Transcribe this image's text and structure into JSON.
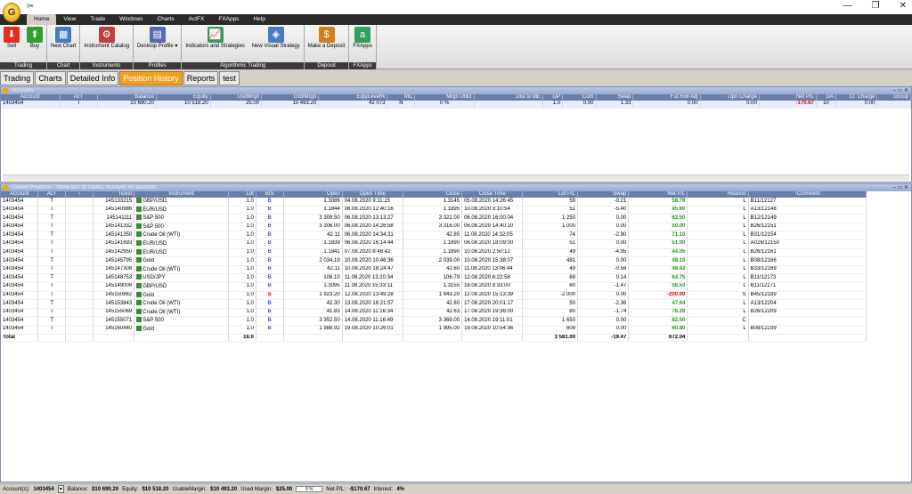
{
  "menu": [
    "Home",
    "View",
    "Trade",
    "Windows",
    "Charts",
    "ActFX",
    "FXApps",
    "Help"
  ],
  "ribbon": {
    "groups": [
      {
        "label": "Trading",
        "buttons": [
          {
            "name": "sell",
            "label": "Sell"
          },
          {
            "name": "buy",
            "label": "Buy"
          }
        ]
      },
      {
        "label": "Chart",
        "buttons": [
          {
            "name": "new-chart",
            "label": "New Chart"
          }
        ]
      },
      {
        "label": "Instruments",
        "buttons": [
          {
            "name": "instrument-catalog",
            "label": "Instrument Catalog"
          }
        ]
      },
      {
        "label": "Profiles",
        "buttons": [
          {
            "name": "desktop-profile",
            "label": "Desktop Profile ▾"
          }
        ]
      },
      {
        "label": "Algorithmic Trading",
        "buttons": [
          {
            "name": "indicators",
            "label": "Indicators and Strategies"
          },
          {
            "name": "new-visual-strategy",
            "label": "New Visual Strategy"
          }
        ]
      },
      {
        "label": "Deposit",
        "buttons": [
          {
            "name": "make-deposit",
            "label": "Make a Deposit"
          }
        ]
      },
      {
        "label": "FXApps",
        "buttons": [
          {
            "name": "fxapps",
            "label": "FXApps"
          }
        ]
      }
    ]
  },
  "tabs": [
    "Trading",
    "Charts",
    "Detailed Info",
    "Position History",
    "Reports",
    "test"
  ],
  "accounts": {
    "title": "Accounts",
    "columns": [
      "Account",
      "AcT",
      "Balance",
      "Equity",
      "UsdMrgn",
      "UsblMrgn",
      "EqtyLevel%",
      "MC",
      "Mrgn Utiliz",
      "Dist to ME",
      "OP",
      "Com",
      "Swap",
      "Fut Roll Adj",
      "Opn Charge",
      "Net P/L",
      "DA",
      "Cl. Charge",
      "Group"
    ],
    "row": [
      "1403454",
      "T",
      "10 690.20",
      "10 518.20",
      "25.00",
      "10 493.20",
      "42 073",
      "N",
      "0 %",
      "",
      "1.0",
      "0.00",
      "1.33",
      "0.00",
      "0.00",
      "-170.67",
      "10",
      "0.00",
      ""
    ]
  },
  "closed": {
    "title": "Closed Positions - Show last 30 trades; Account: All accounts",
    "columns": [
      "Account",
      "AcT",
      "↑",
      "Ticket",
      "Instrument",
      "Lot",
      "B/S",
      "Open",
      "Open Time",
      "Close",
      "Close Time",
      "Lot P/L",
      "Swap",
      "Net P/L",
      "Reason",
      "↑Comment"
    ],
    "rows": [
      [
        "1403454",
        "T",
        "",
        "145133215",
        "GBP/USD",
        "1.0",
        "B",
        "1.3086",
        "04.08.2020 9:11:15",
        "1.3145",
        "05.08.2020 14:26:45",
        "59",
        "-0.21",
        "58.79",
        "L",
        "B11/12127"
      ],
      [
        "1403454",
        "T",
        "",
        "145140986",
        "EUR/USD",
        "1.0",
        "B",
        "1.1844",
        "06.08.2020 12:40:16",
        "1.1895",
        "10.08.2020 3:10:54",
        "51",
        "-5.40",
        "45.60",
        "L",
        "A13/12148"
      ],
      [
        "1403454",
        "T",
        "",
        "145141111",
        "S&P 500",
        "1.0",
        "B",
        "3 309.50",
        "06.08.2020 13:13:27",
        "3 322.00",
        "06.08.2020 16:00:04",
        "1 250",
        "0.00",
        "62.50",
        "L",
        "B12/12149"
      ],
      [
        "1403454",
        "T",
        "",
        "145141332",
        "S&P 500",
        "1.0",
        "B",
        "3 306.00",
        "06.08.2020 14:26:58",
        "3 316.00",
        "06.08.2020 14:40:10",
        "1 000",
        "0.00",
        "50.00",
        "L",
        "B26/12151"
      ],
      [
        "1403454",
        "T",
        "",
        "145141350",
        "Crude Oil (WTI)",
        "1.0",
        "B",
        "42.11",
        "06.08.2020 14:34:31",
        "42.85",
        "11.08.2020 14:32:05",
        "74",
        "-2.90",
        "71.10",
        "L",
        "B31/12154"
      ],
      [
        "1403454",
        "T",
        "",
        "145141693",
        "EUR/USD",
        "1.0",
        "B",
        "1.1839",
        "06.08.2020 16:14:44",
        "1.1890",
        "06.08.2020 18:09:00",
        "51",
        "0.00",
        "51.00",
        "L",
        "A026/12150"
      ],
      [
        "1403454",
        "T",
        "",
        "145142950",
        "EUR/USD",
        "1.0",
        "B",
        "1.1841",
        "07.08.2020 8:46:42",
        "1.1890",
        "10.08.2020 2:50:12",
        "49",
        "-4.95",
        "44.05",
        "L",
        "B26/12161"
      ],
      [
        "1403454",
        "T",
        "",
        "145145795",
        "Gold",
        "1.0",
        "B",
        "2 034.19",
        "10.08.2020 10:46:36",
        "2 039.00",
        "10.08.2020 15:38:07",
        "481",
        "0.00",
        "48.10",
        "L",
        "B08/12166"
      ],
      [
        "1403454",
        "T",
        "",
        "145147308",
        "Crude Oil (WTI)",
        "1.0",
        "B",
        "42.11",
        "10.08.2020 18:24:47",
        "42.60",
        "11.08.2020 13:06:44",
        "49",
        "-0.58",
        "48.42",
        "L",
        "B33/12169"
      ],
      [
        "1403454",
        "T",
        "",
        "145148753",
        "USD/JPY",
        "1.0",
        "B",
        "106.10",
        "11.08.2020 13:20:34",
        "106.79",
        "12.08.2020 6:22:58",
        "69",
        "0.14",
        "64.75",
        "L",
        "B11/12173"
      ],
      [
        "1403454",
        "T",
        "",
        "145149006",
        "GBP/USD",
        "1.0",
        "B",
        "1.3095",
        "11.08.2020 15:33:11",
        "1.3155",
        "18.08.2020 8:33:00",
        "60",
        "-1.47",
        "58.53",
        "L",
        "B11/12171"
      ],
      [
        "1403454",
        "T",
        "",
        "145150862",
        "Gold",
        "1.0",
        "S",
        "1 923.20",
        "12.08.2020 13:49:28",
        "1 943.20",
        "12.08.2020 15:13:39",
        "-2 000",
        "0.00",
        "-200.00",
        "S",
        "B45/12189"
      ],
      [
        "1403454",
        "T",
        "",
        "145153843",
        "Crude Oil (WTI)",
        "1.0",
        "B",
        "42.30",
        "13.08.2020 18:21:57",
        "42.80",
        "17.08.2020 20:01:17",
        "50",
        "-2.36",
        "47.64",
        "L",
        "A13/12204"
      ],
      [
        "1403454",
        "T",
        "",
        "145155069",
        "Crude Oil (WTI)",
        "1.0",
        "B",
        "41.83",
        "14.08.2020 11:16:34",
        "42.63",
        "17.08.2020 19:36:00",
        "80",
        "-1.74",
        "78.26",
        "L",
        "B26/12209"
      ],
      [
        "1403454",
        "T",
        "",
        "145155071",
        "S&P 500",
        "1.0",
        "B",
        "3 352.50",
        "14.08.2020 11:16:49",
        "3 369.00",
        "14.08.2020 19:11:01",
        "1 650",
        "0.00",
        "82.50",
        "C",
        ""
      ],
      [
        "1403454",
        "T",
        "",
        "145160440",
        "Gold",
        "1.0",
        "B",
        "1 988.92",
        "19.08.2020 10:26:01",
        "1 995.00",
        "19.08.2020 10:54:36",
        "608",
        "0.00",
        "60.80",
        "L",
        "B08/12239"
      ]
    ],
    "total": {
      "label": "Total",
      "lot": "16.0",
      "lot_pl": "3 581.00",
      "swap": "-19.47",
      "net_pl": "672.04"
    }
  },
  "status": {
    "account_label": "Account(s):",
    "account": "1403454",
    "balance_label": "Balance:",
    "balance": "$10 690.20",
    "equity_label": "Equity:",
    "equity": "$10 518.20",
    "usable_label": "UsableMargin:",
    "usable": "$10 493.20",
    "used_label": "Used Margin:",
    "used": "$25.00",
    "util": "0 %",
    "netpl_label": "Net P/L:",
    "netpl": "-$170.67",
    "interest_label": "Interest:",
    "interest": "4%"
  },
  "colors": {
    "accent": "#f0a020",
    "header": "#6a7ea8",
    "profit": "#1a9a1a",
    "loss": "#d00000"
  }
}
